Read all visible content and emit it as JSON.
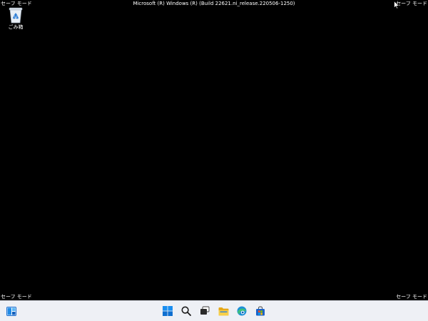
{
  "desktop": {
    "safe_mode_label": "セーフ モード",
    "build_info": "Microsoft (R) Windows (R) (Build 22621.ni_release.220506-1250)",
    "icons": [
      {
        "label": "ごみ箱",
        "icon": "recycle-bin-icon"
      }
    ]
  },
  "taskbar": {
    "widgets": {
      "icon": "widgets-icon"
    },
    "apps": [
      {
        "icon": "start-icon"
      },
      {
        "icon": "search-icon"
      },
      {
        "icon": "task-view-icon"
      },
      {
        "icon": "file-explorer-icon"
      },
      {
        "icon": "edge-icon"
      },
      {
        "icon": "store-icon"
      }
    ]
  },
  "colors": {
    "desktop_background": "#000000",
    "taskbar_background": "#eef0f5",
    "accent_blue": "#0078d4"
  }
}
